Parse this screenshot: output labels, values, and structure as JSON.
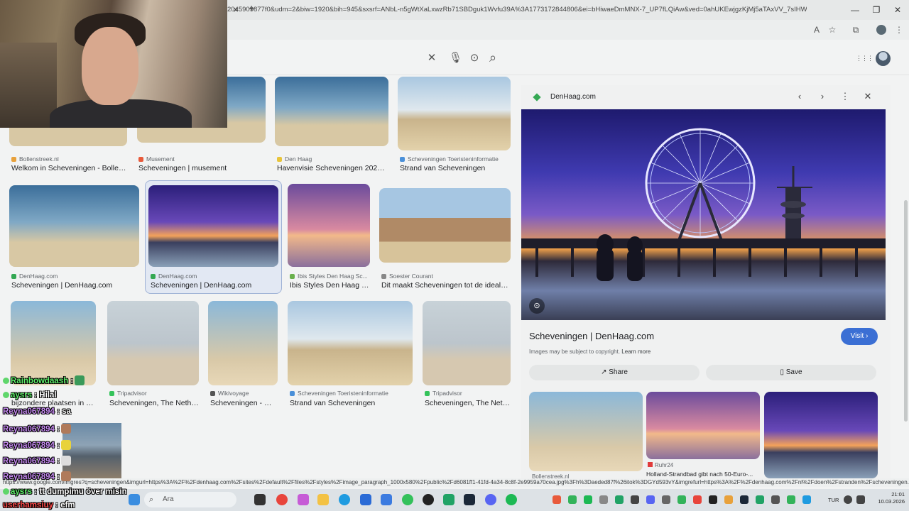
{
  "browser": {
    "url": "2045909877f0&udm=2&biw=1920&bih=945&sxsrf=ANbL-n5gWtXaLxwzRb71SBDguk1Wvfu39A%3A1773172844806&ei=bHiwaeDmMNX-7_UP7fLQiAw&ved=0ahUKEwjgzKjMj5aTAxVV_7sIHW05F...",
    "tab_close": "×",
    "new_tab": "+",
    "minimize": "—",
    "restore": "❐",
    "close": "✕",
    "translate_icon": "A",
    "bookmark_icon": "☆",
    "extensions_icon": "⧉",
    "menu_icon": "⋮"
  },
  "search": {
    "clear_icon": "✕",
    "mic_icon": "🎙",
    "lens_icon": "⊙",
    "search_icon": "⌕",
    "apps_icon": "⋮⋮⋮"
  },
  "results": [
    {
      "source": "Bollenstreek.nl",
      "title": "Welkom in Scheveningen - Bollenst...",
      "fav": "#e8a13b"
    },
    {
      "source": "Musement",
      "title": "Scheveningen | musement",
      "fav": "#e85a3b"
    },
    {
      "source": "Den Haag",
      "title": "Havenvisie Scheveningen 2025–...",
      "fav": "#e8c43b"
    },
    {
      "source": "Scheveningen Toeristeninformatie",
      "title": "Strand van Scheveningen",
      "fav": "#4a90d9"
    },
    {
      "source": "DenHaag.com",
      "title": "Scheveningen | DenHaag.com",
      "fav": "#34a853"
    },
    {
      "source": "DenHaag.com",
      "title": "Scheveningen | DenHaag.com",
      "fav": "#34a853"
    },
    {
      "source": "Ibis Styles Den Haag Sc...",
      "title": "Ibis Styles Den Haag S...",
      "fav": "#6ab04c"
    },
    {
      "source": "Soester Courant",
      "title": "Dit maakt Scheveningen tot de ideale ...",
      "fav": "#888888"
    },
    {
      "source": "",
      "title": "bijzondere plaatsen in Sc...",
      "fav": "#cccccc"
    },
    {
      "source": "Tripadvisor",
      "title": "Scheveningen, The Nether...",
      "fav": "#34c35a"
    },
    {
      "source": "Wikivoyage",
      "title": "Scheveningen - Wi...",
      "fav": "#555555"
    },
    {
      "source": "Scheveningen Toeristeninformatie",
      "title": "Strand van Scheveningen",
      "fav": "#4a90d9"
    },
    {
      "source": "Tripadvisor",
      "title": "Scheveningen, The Neth...",
      "fav": "#34c35a"
    }
  ],
  "panel": {
    "source": "DenHaag.com",
    "prev_icon": "‹",
    "next_icon": "›",
    "more_icon": "⋮",
    "close_icon": "✕",
    "lens_icon": "⊙",
    "title": "Scheveningen | DenHaag.com",
    "note": "Images may be subject to copyright.",
    "learn_more": "Learn more",
    "visit": "Visit ›",
    "share": "Share",
    "save": "Save",
    "related": [
      {
        "source": "Bollenstreek.nl",
        "title": ""
      },
      {
        "source": "Ruhr24",
        "title": "Holland-Strandbad gibt nach 50-Euro-..."
      },
      {
        "source": "",
        "title": ""
      }
    ]
  },
  "status_url": "https://www.google.com/imgres?q=scheveningen&imgurl=https%3A%2F%2Fdenhaag.com%2Fsites%2Fdefault%2Ffiles%2Fstyles%2Fimage_paragraph_1000x580%2Fpublic%2Fd6081ff1-41fd-4a34-8c8f-2e9959a70cea.jpg%3Fh%3Daeded87f%26itok%3DGYd593vY&imgrefurl=https%3A%2F%2Fdenhaag.com%2Fnl%2Fdoen%2Fstranden%2Fscheveningen...",
  "taskbar": {
    "search_placeholder": "Ara",
    "search_icon": "⌕",
    "language": "TUR",
    "time": "21:01",
    "date": "10.03.2026"
  },
  "chat": [
    {
      "user": "Rainbowdaash",
      "sep": " :",
      "msg": "",
      "color": "#5ef06a"
    },
    {
      "user": "aysrs",
      "sep": " :",
      "msg": "Hilal",
      "color": "#5ef06a"
    },
    {
      "user": "Reyna067894",
      "sep": " :",
      "msg": "sa",
      "color": "#c58af0"
    },
    {
      "user": "Reyna067894",
      "sep": " :",
      "msg": "",
      "color": "#c58af0"
    },
    {
      "user": "Reyna067894",
      "sep": " :",
      "msg": "",
      "color": "#c58af0"
    },
    {
      "user": "Reyna067894",
      "sep": " :",
      "msg": "",
      "color": "#c58af0"
    },
    {
      "user": "Reyna067894",
      "sep": " :",
      "msg": "",
      "color": "#c58af0"
    },
    {
      "user": "aysrs",
      "sep": " :",
      "msg": "tt dumpimu över misin",
      "color": "#5ef06a"
    },
    {
      "user": "userhamsiuy",
      "sep": " :",
      "msg": "efm",
      "color": "#ff4a4a"
    }
  ]
}
